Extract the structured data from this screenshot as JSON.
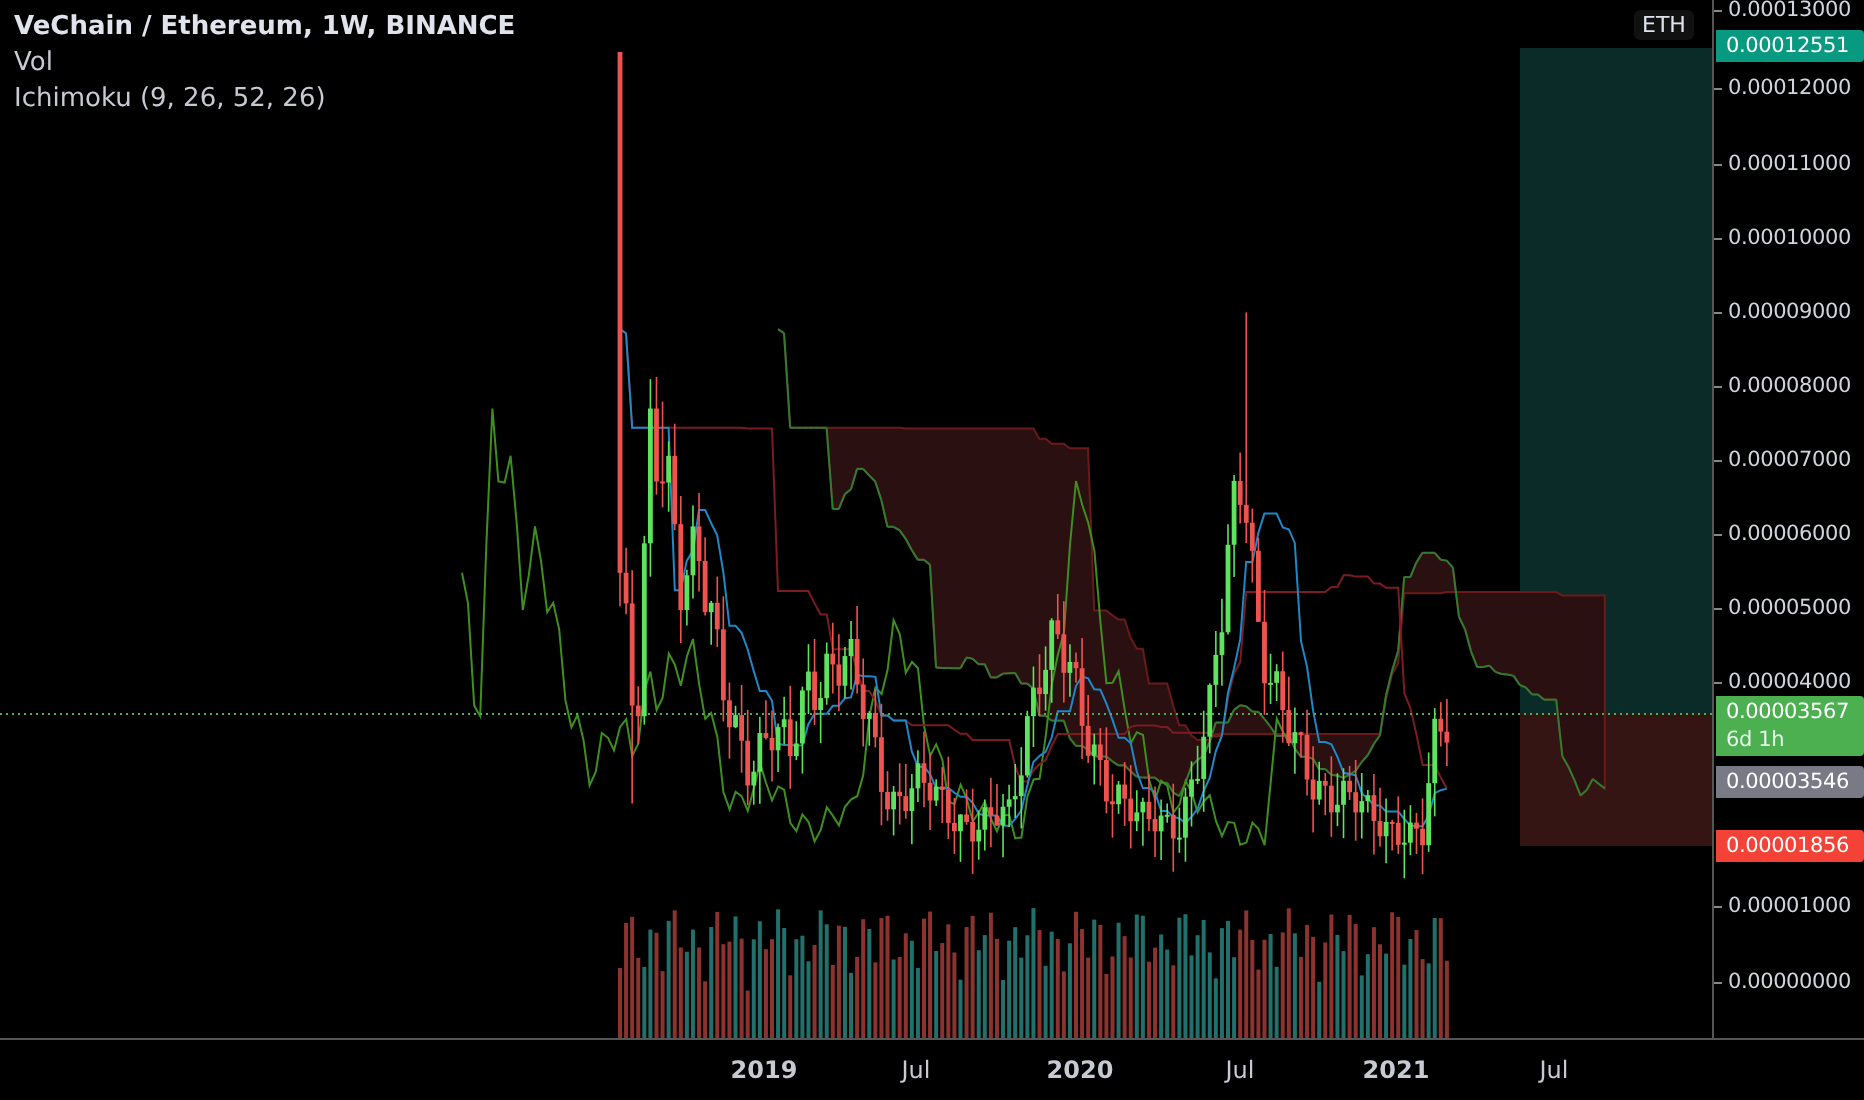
{
  "legend": {
    "title": "VeChain / Ethereum, 1W, BINANCE",
    "indicators": [
      "Vol",
      "Ichimoku (9, 26, 52, 26)"
    ]
  },
  "price_axis": {
    "ticks": [
      "0.00013000",
      "0.00012000",
      "0.00011000",
      "0.00010000",
      "0.00009000",
      "0.00008000",
      "0.00007000",
      "0.00006000",
      "0.00005000",
      "0.00004000",
      "0.00001000",
      "0.00000000"
    ]
  },
  "currency_badge": "ETH",
  "price_labels": [
    {
      "value": "0.00012551",
      "color": "#089981"
    },
    {
      "value": "0.00003567",
      "countdown": "6d 1h",
      "color": "#4caf50"
    },
    {
      "value": "0.00003546",
      "color": "#787b86"
    },
    {
      "value": "0.00001856",
      "color": "#f44336"
    }
  ],
  "time_axis": {
    "ticks": [
      {
        "label": "2019",
        "kind": "year"
      },
      {
        "label": "Jul",
        "kind": "month"
      },
      {
        "label": "2020",
        "kind": "year"
      },
      {
        "label": "Jul",
        "kind": "month"
      },
      {
        "label": "2021",
        "kind": "year"
      },
      {
        "label": "Jul",
        "kind": "month"
      }
    ]
  }
}
